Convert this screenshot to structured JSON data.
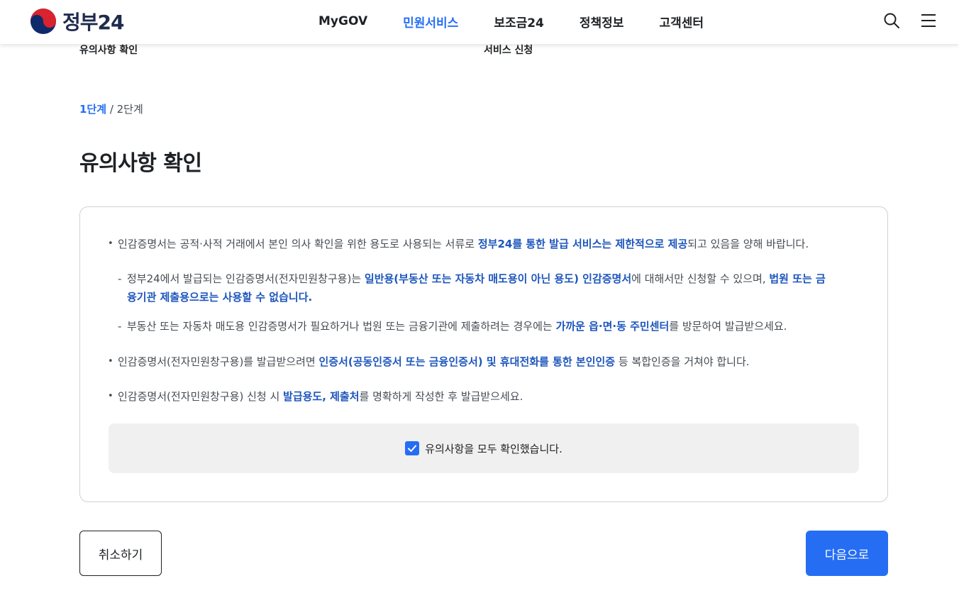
{
  "header": {
    "logo_text": "정부24",
    "nav": [
      {
        "label": "MyGOV"
      },
      {
        "label": "민원서비스",
        "active": true
      },
      {
        "label": "보조금24"
      },
      {
        "label": "정책정보"
      },
      {
        "label": "고객센터"
      }
    ],
    "icons": [
      "search-icon",
      "menu-icon"
    ]
  },
  "steps_strip": {
    "step1": "유의사항 확인",
    "step2": "서비스 신청"
  },
  "step_indicator": {
    "current": "1단계",
    "separator": " / ",
    "next": "2단계"
  },
  "page_title": "유의사항 확인",
  "notices": {
    "n1": {
      "a": "인감증명서는 공적·사적 거래에서 본인 의사 확인을 위한 용도로 사용되는 서류로 ",
      "b": "정부24를 통한 발급 서비스는 제한적으로 제공",
      "c": "되고 있음을 양해 바랍니다."
    },
    "n1_sub1": {
      "a": "정부24에서 발급되는 인감증명서(전자민원창구용)는 ",
      "b": "일반용(부동산 또는 자동차 매도용이 아닌 용도) 인감증명서",
      "c": "에 대해서만 신청할 수 있으며, ",
      "d": "법원 또는 금",
      "e": "융기관 제출용으로는 사용할 수 없습니다."
    },
    "n1_sub2": {
      "a": "부동산 또는 자동차 매도용 인감증명서가 필요하거나 법원 또는 금융기관에 제출하려는 경우에는 ",
      "b": "가까운 읍·면·동 주민센터",
      "c": "를 방문하여 발급받으세요."
    },
    "n2": {
      "a": "인감증명서(전자민원창구용)를 발급받으려면 ",
      "b": "인증서(공동인증서 또는 금융인증서) 및 휴대전화를 통한 본인인증",
      "c": " 등 복합인증을 거쳐야 합니다."
    },
    "n3": {
      "a": "인감증명서(전자민원창구용) 신청 시 ",
      "b": "발급용도, 제출처",
      "c": "를 명확하게 작성한 후 발급받으세요."
    }
  },
  "confirm": {
    "checked": true,
    "label": "유의사항을 모두 확인했습니다."
  },
  "buttons": {
    "cancel": "취소하기",
    "next": "다음으로"
  },
  "colors": {
    "accent": "#256ef4",
    "highlight_text": "#1d56bc",
    "confirm_bg": "#f0f0f0"
  }
}
